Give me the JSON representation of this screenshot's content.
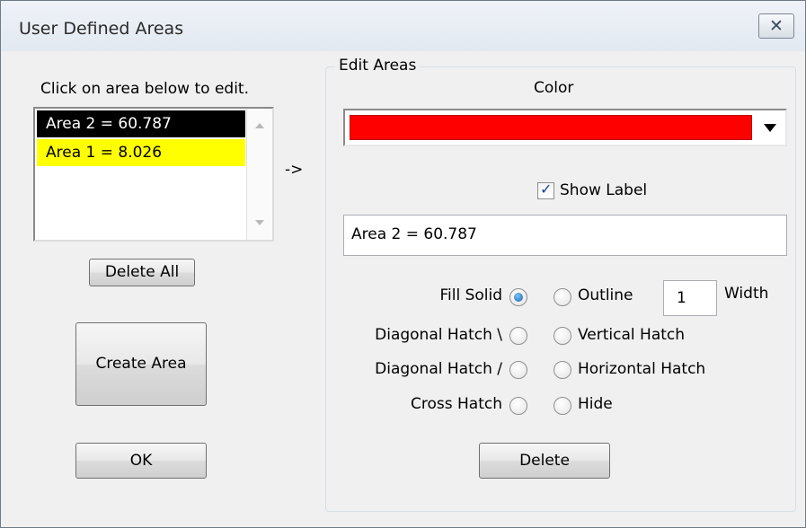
{
  "window": {
    "title": "User Defined Areas",
    "close_glyph": "✕"
  },
  "left": {
    "instruction": "Click on area below to edit.",
    "areas": [
      {
        "label": "Area 2 = 60.787",
        "bg": "#000000",
        "fg": "#ffffff"
      },
      {
        "label": "Area 1 = 8.026",
        "bg": "#ffff00",
        "fg": "#000000"
      }
    ],
    "delete_all": "Delete All",
    "create_area": "Create Area",
    "ok": "OK"
  },
  "arrow": "->",
  "edit": {
    "group_label": "Edit Areas",
    "color_label": "Color",
    "selected_color": "#ff0000",
    "show_label": {
      "text": "Show Label",
      "checked": true,
      "check_glyph": "✓"
    },
    "label_text": "Area 2 = 60.787",
    "fill_left": [
      {
        "label": "Fill Solid",
        "checked": true
      },
      {
        "label": "Diagonal Hatch \\",
        "checked": false
      },
      {
        "label": "Diagonal Hatch /",
        "checked": false
      },
      {
        "label": "Cross Hatch",
        "checked": false
      }
    ],
    "fill_right": [
      {
        "label": "Outline",
        "checked": false
      },
      {
        "label": "Vertical Hatch",
        "checked": false
      },
      {
        "label": "Horizontal Hatch",
        "checked": false
      },
      {
        "label": "Hide",
        "checked": false
      }
    ],
    "width_value": "1",
    "width_label": "Width",
    "delete": "Delete"
  }
}
